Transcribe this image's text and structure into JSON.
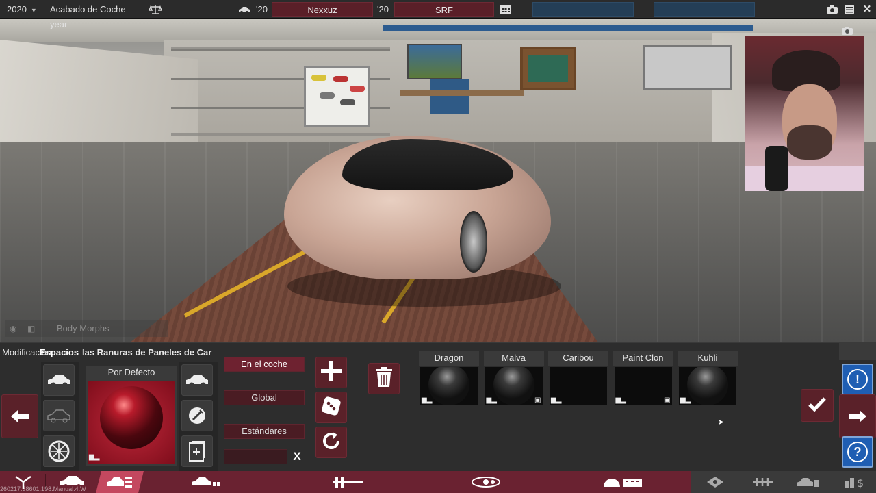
{
  "topbar": {
    "year": "2020",
    "title": "Acabado de Coche year",
    "car_year_left": "'20",
    "name": "Nexxuz",
    "car_year_right": "'20",
    "trim": "SRF",
    "slot1": "",
    "slot2": ""
  },
  "mode": {
    "label": "Body Morphs"
  },
  "panel": {
    "tab_label": "Modificación",
    "current_label": "Espacios",
    "title_rest": "las Ranuras de Paneles de Car",
    "paint_label": "Por Defecto",
    "options": [
      "En el coche",
      "Global",
      "Estándares"
    ],
    "name_input_value": "",
    "clear_label": "X"
  },
  "presets": [
    {
      "name": "Dragon",
      "has_save": false,
      "thumb": "dark-sphere"
    },
    {
      "name": "Malva",
      "has_save": true,
      "thumb": "dark-sphere"
    },
    {
      "name": "Caribou",
      "has_save": false,
      "thumb": "black"
    },
    {
      "name": "Paint Clon",
      "has_save": true,
      "thumb": "black"
    },
    {
      "name": "Kuhli",
      "has_save": false,
      "thumb": "dark-sphere"
    }
  ],
  "build_text": "260217.38601.198.Manual.4.W",
  "colors": {
    "accent_red": "#5a2129",
    "nav_red": "#6a2231",
    "active_tab": "#c4485f",
    "help_blue": "#1f5eb3"
  },
  "icons": {
    "balance": "balance-icon",
    "car": "car-icon",
    "calendar": "calendar-icon",
    "camera": "camera-icon",
    "menu": "menu-icon",
    "close": "close-icon",
    "plus": "plus-icon",
    "trash": "trash-icon",
    "dice": "dice-icon",
    "reset": "reset-icon",
    "check": "checkmark-icon",
    "alert": "alert-icon",
    "help": "help-icon"
  }
}
